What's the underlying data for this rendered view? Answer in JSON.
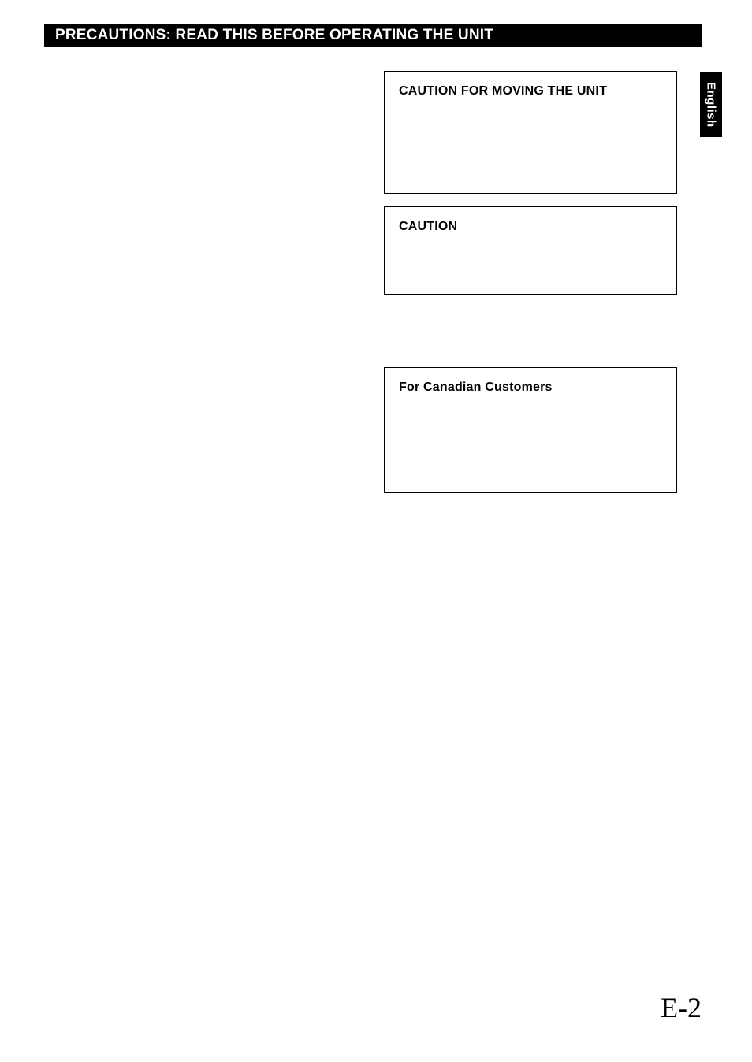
{
  "header": {
    "title": "PRECAUTIONS: READ THIS BEFORE OPERATING THE UNIT"
  },
  "side_tab": {
    "label": "English"
  },
  "boxes": {
    "moving": {
      "title": "CAUTION FOR MOVING THE UNIT"
    },
    "caution": {
      "title": "CAUTION"
    },
    "canadian": {
      "title": "For Canadian Customers"
    }
  },
  "page_number": "E-2"
}
